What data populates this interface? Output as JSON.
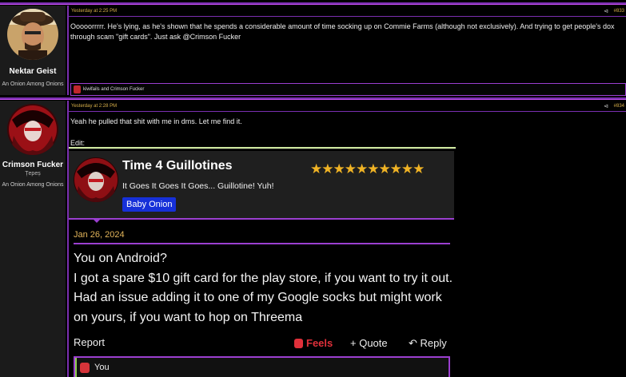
{
  "posts": [
    {
      "user": {
        "name": "Nektar Geist",
        "title": "An Onion Among Onions"
      },
      "header": {
        "date": "Yesterday at 2:25 PM",
        "share_icon": "share-icon",
        "number": "#833"
      },
      "body": "Ooooorrrrr. He's lying, as he's shown that he spends a considerable amount of time socking up on Commie Farms (although not exclusively). And trying to get people's dox through scam \"gift cards\". Just ask @Crimson Fucker",
      "reactions": {
        "text": "kiwifails and Crimson Fucker"
      }
    },
    {
      "user": {
        "name": "Crimson Fucker",
        "subtitle": "Țepeș",
        "title": "An Onion Among Onions"
      },
      "header": {
        "date": "Yesterday at 2:28 PM",
        "share_icon": "share-icon",
        "number": "#834"
      },
      "body_line1": "Yeah he pulled that shit with me in dms. Let me find it.",
      "body_line2": "Edit:",
      "screenshot": {
        "name": "Time 4 Guillotines",
        "stars": "★★★★★★★★★★",
        "title": "It Goes It Goes It Goes... Guillotine! Yuh!",
        "badge": "Baby Onion",
        "date": "Jan 26, 2024",
        "message": "You on Android?\nI got a spare $10 gift card for the play store, if you want to try it out. Had an issue adding it to one of my Google socks but might work on yours, if you want to hop on Threema",
        "report": "Report",
        "feels": "Feels",
        "quote": "Quote",
        "reply": "Reply",
        "reaction_you": "You"
      }
    }
  ],
  "colors": {
    "accent": "#9b3fd0",
    "date": "#d8b04a",
    "badge": "#1630d8",
    "stars": "#f0b325",
    "feels": "#e0303a"
  }
}
